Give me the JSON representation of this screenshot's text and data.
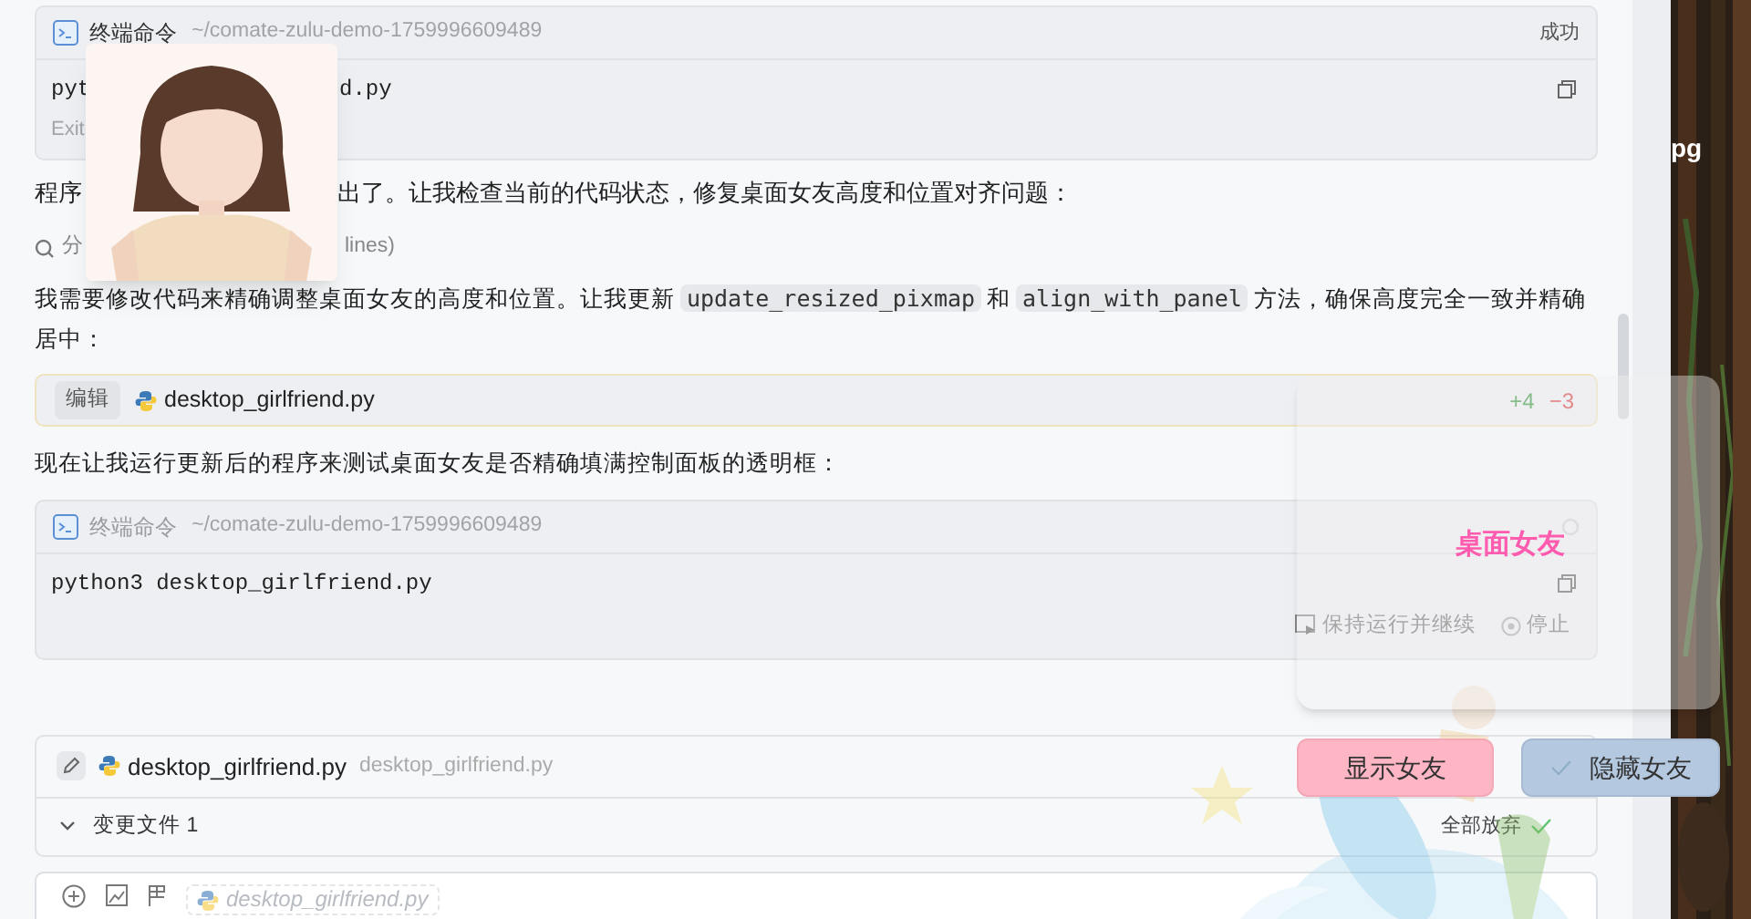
{
  "blocks": [
    {
      "kind": "terminal",
      "title": "终端命令",
      "path": "~/comate-zulu-demo-1759996609489",
      "status": "成功",
      "command": [
        "pyt",
        "d.py"
      ],
      "output": "Exit",
      "running": false
    },
    {
      "kind": "fragments",
      "text": [
        "程序",
        "出了。让我检查当前的代码状态，修复桌面女友高度和位置对齐问题："
      ]
    },
    {
      "kind": "search",
      "text": [
        "分",
        "lines)"
      ]
    },
    {
      "kind": "paragraph",
      "parts": [
        {
          "kind": "text",
          "text": "我需要修改代码来精确调整桌面女友的高度和位置。让我更新 "
        },
        {
          "kind": "code",
          "text": "update_resized_pixmap"
        },
        {
          "kind": "text",
          "text": " 和 "
        },
        {
          "kind": "code",
          "text": "align_with_panel"
        },
        {
          "kind": "text",
          "text": " 方法，确保高度完全一致并精确居中："
        }
      ]
    },
    {
      "kind": "edit",
      "badge": "编辑",
      "file": "desktop_girlfriend.py",
      "added": "+4",
      "removed": "−3"
    },
    {
      "kind": "paragraph",
      "parts": [
        {
          "kind": "text",
          "text": "现在让我运行更新后的程序来测试桌面女友是否精确填满控制面板的透明框："
        }
      ]
    },
    {
      "kind": "terminal",
      "title": "终端命令",
      "path": "~/comate-zulu-demo-1759996609489",
      "command": [
        "python3 desktop_girlfriend.py"
      ],
      "running": true,
      "actions": [
        "保持运行并继续",
        "停止"
      ]
    }
  ],
  "changes": {
    "file": "desktop_girlfriend.py",
    "path": "desktop_girlfriend.py",
    "summary": "变更文件 1",
    "discard": "全部放弃"
  },
  "input": {
    "chip": "desktop_girlfriend.py"
  },
  "widget": {
    "title": "桌面女友",
    "buttons": [
      {
        "kind": "show",
        "label": "显示女友"
      },
      {
        "kind": "hide",
        "label": "隐藏女友"
      }
    ]
  },
  "desktop": {
    "label": "pg"
  }
}
